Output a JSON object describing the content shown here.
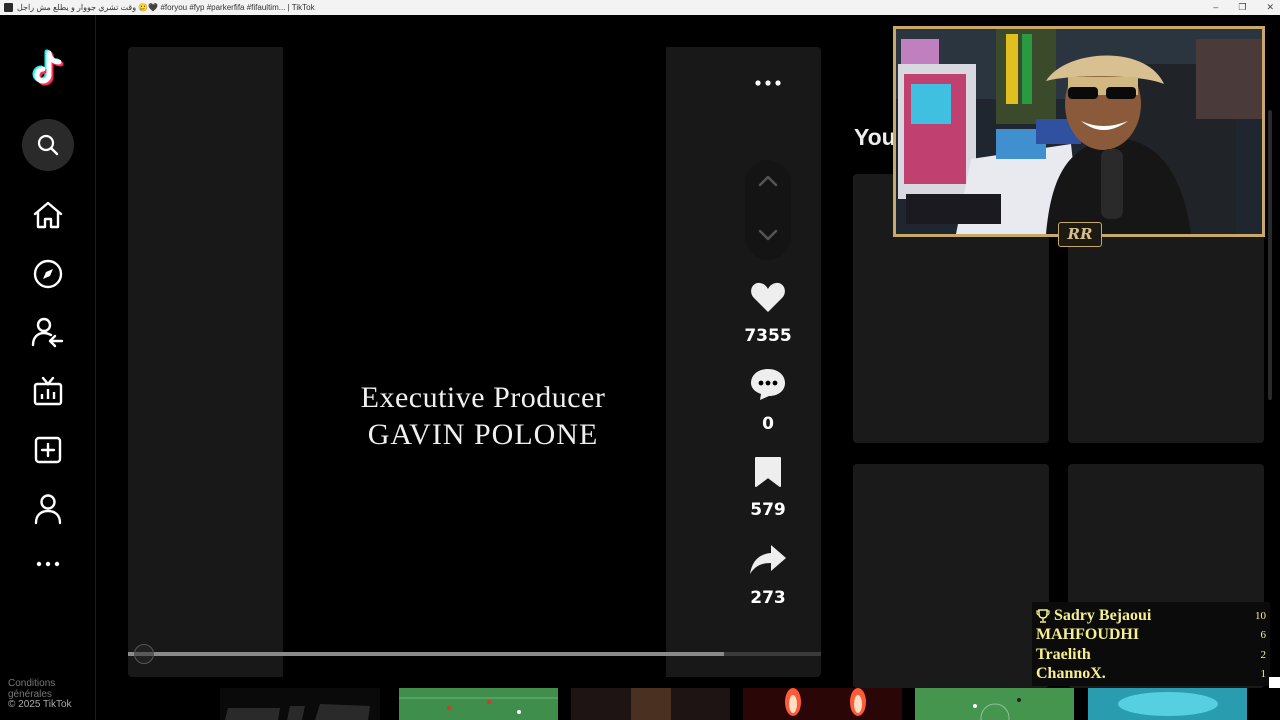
{
  "window": {
    "title": "وقت تشري جووار و يطلع مش راجل 🥲🖤 #foryou #fyp #parkerfifa #fifaultim... | TikTok",
    "controls": [
      "–",
      "❐",
      "✕"
    ]
  },
  "sidebar": {
    "nav": [
      {
        "name": "search",
        "icon": "search-icon"
      },
      {
        "name": "home",
        "icon": "home-icon"
      },
      {
        "name": "explore",
        "icon": "compass-icon"
      },
      {
        "name": "following",
        "icon": "user-follow-icon"
      },
      {
        "name": "live",
        "icon": "live-tv-icon"
      },
      {
        "name": "upload",
        "icon": "plus-square-icon"
      },
      {
        "name": "profile",
        "icon": "user-icon"
      },
      {
        "name": "more",
        "icon": "more-dots-icon"
      }
    ],
    "footer_partial": "Conditions générales",
    "copyright": "© 2025 TikTok"
  },
  "video": {
    "credit_line1": "Executive Producer",
    "credit_line2": "GAVIN POLONE",
    "progress": 0.86
  },
  "actions": {
    "likes": "7355",
    "comments": "0",
    "saves": "579",
    "shares": "273"
  },
  "right_panel": {
    "title_partial": "You"
  },
  "overlay": {
    "badge": "RR",
    "leaderboard": [
      {
        "name": "Sadry Bejaoui",
        "score": "10",
        "trophy": true
      },
      {
        "name": "MAHFOUDHI",
        "score": "6",
        "trophy": false
      },
      {
        "name": "Traelith",
        "score": "2",
        "trophy": false
      },
      {
        "name": "ChannoX.",
        "score": "1",
        "trophy": false
      }
    ]
  },
  "colors": {
    "accent_cyan": "#25F4EE",
    "accent_red": "#FE2C55",
    "overlay_gold": "#c9a96a",
    "leaderboard_text": "#f7f08c"
  }
}
